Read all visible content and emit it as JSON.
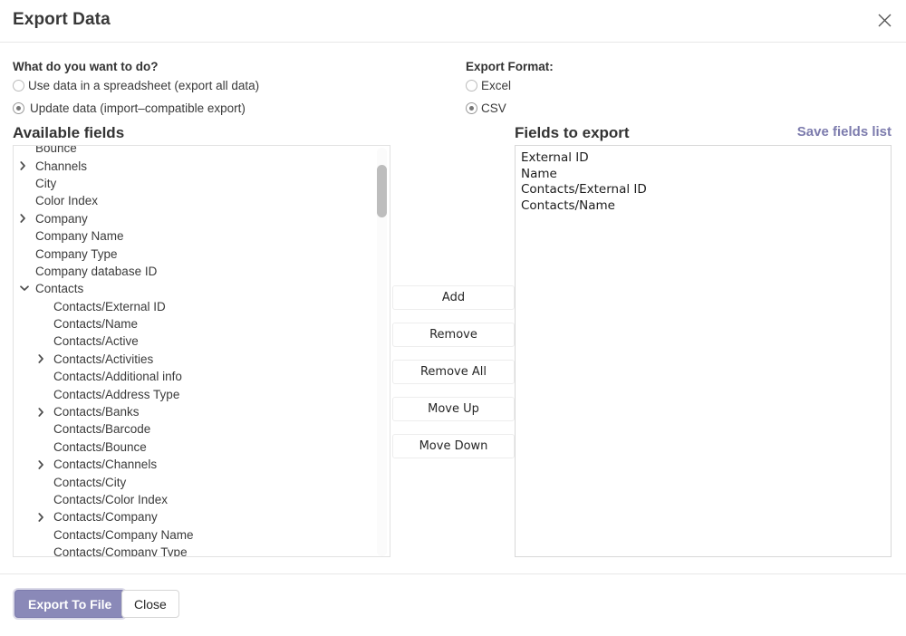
{
  "dialog": {
    "title": "Export Data",
    "close_icon": "close-icon"
  },
  "what_to_do": {
    "label": "What do you want to do?",
    "options": [
      {
        "label": "Use data in a spreadsheet (export all data)",
        "selected": false
      },
      {
        "label": "Update data (import–compatible export)",
        "selected": true
      }
    ]
  },
  "export_format": {
    "label": "Export Format:",
    "options": [
      {
        "label": "Excel",
        "selected": false
      },
      {
        "label": "CSV",
        "selected": true
      }
    ]
  },
  "available_fields": {
    "heading": "Available fields",
    "items": [
      {
        "label": "Bounce",
        "level": 0,
        "toggle": "none"
      },
      {
        "label": "Channels",
        "level": 0,
        "toggle": "collapsed"
      },
      {
        "label": "City",
        "level": 0,
        "toggle": "none"
      },
      {
        "label": "Color Index",
        "level": 0,
        "toggle": "none"
      },
      {
        "label": "Company",
        "level": 0,
        "toggle": "collapsed"
      },
      {
        "label": "Company Name",
        "level": 0,
        "toggle": "none"
      },
      {
        "label": "Company Type",
        "level": 0,
        "toggle": "none"
      },
      {
        "label": "Company database ID",
        "level": 0,
        "toggle": "none"
      },
      {
        "label": "Contacts",
        "level": 0,
        "toggle": "expanded"
      },
      {
        "label": "Contacts/External ID",
        "level": 1,
        "toggle": "none"
      },
      {
        "label": "Contacts/Name",
        "level": 1,
        "toggle": "none"
      },
      {
        "label": "Contacts/Active",
        "level": 1,
        "toggle": "none"
      },
      {
        "label": "Contacts/Activities",
        "level": 1,
        "toggle": "collapsed"
      },
      {
        "label": "Contacts/Additional info",
        "level": 1,
        "toggle": "none"
      },
      {
        "label": "Contacts/Address Type",
        "level": 1,
        "toggle": "none"
      },
      {
        "label": "Contacts/Banks",
        "level": 1,
        "toggle": "collapsed"
      },
      {
        "label": "Contacts/Barcode",
        "level": 1,
        "toggle": "none"
      },
      {
        "label": "Contacts/Bounce",
        "level": 1,
        "toggle": "none"
      },
      {
        "label": "Contacts/Channels",
        "level": 1,
        "toggle": "collapsed"
      },
      {
        "label": "Contacts/City",
        "level": 1,
        "toggle": "none"
      },
      {
        "label": "Contacts/Color Index",
        "level": 1,
        "toggle": "none"
      },
      {
        "label": "Contacts/Company",
        "level": 1,
        "toggle": "collapsed"
      },
      {
        "label": "Contacts/Company Name",
        "level": 1,
        "toggle": "none"
      },
      {
        "label": "Contacts/Company Type",
        "level": 1,
        "toggle": "none"
      }
    ]
  },
  "transfer_buttons": [
    {
      "label": "Add"
    },
    {
      "label": "Remove"
    },
    {
      "label": "Remove All"
    },
    {
      "label": "Move Up"
    },
    {
      "label": "Move Down"
    }
  ],
  "fields_to_export": {
    "heading": "Fields to export",
    "save_link": "Save fields list",
    "items": [
      "External ID",
      "Name",
      "Contacts/External ID",
      "Contacts/Name"
    ]
  },
  "footer": {
    "primary_label": "Export To File",
    "secondary_label": "Close"
  },
  "colors": {
    "accent": "#7c7bad",
    "primary_button_bg": "#8a89b8",
    "text": "#2b2b2b"
  }
}
